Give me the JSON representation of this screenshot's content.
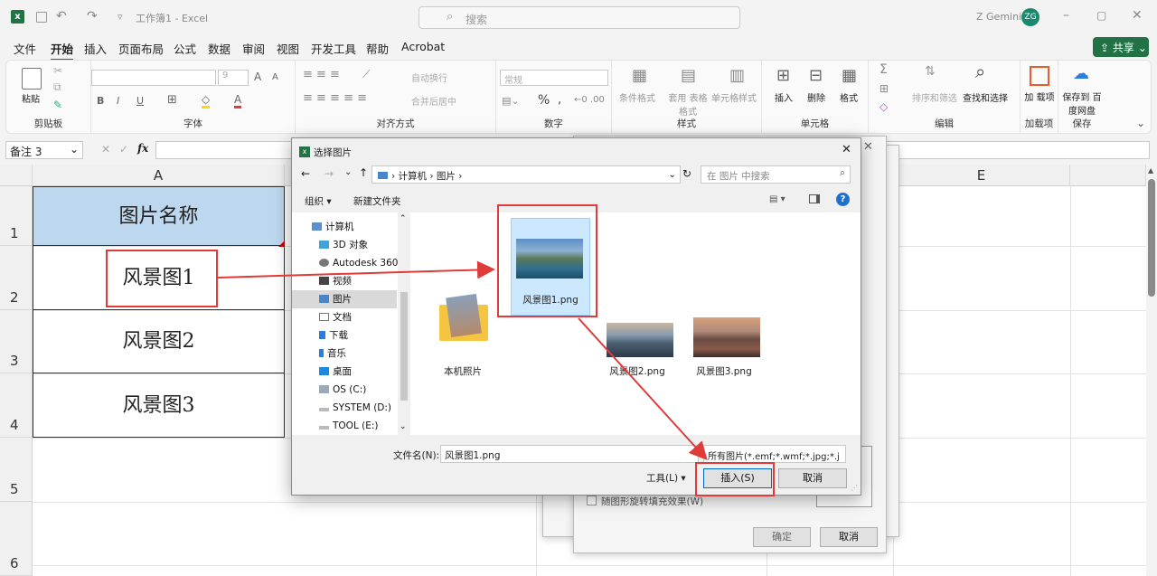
{
  "app": {
    "doc_title": "工作簿1 - Excel",
    "search_placeholder": "搜索",
    "user_name": "Z Gemini",
    "user_initials": "ZG",
    "share_label": "共享"
  },
  "menu": [
    "文件",
    "开始",
    "插入",
    "页面布局",
    "公式",
    "数据",
    "审阅",
    "视图",
    "开发工具",
    "帮助",
    "Acrobat"
  ],
  "ribbon": {
    "clipboard": {
      "paste": "粘贴",
      "label": "剪贴板"
    },
    "font": {
      "label": "字体",
      "size": "9",
      "bold": "B",
      "italic": "I",
      "underline": "U",
      "grow": "A",
      "shrink": "A"
    },
    "alignment": {
      "wrap": "自动换行",
      "merge": "合并后居中",
      "label": "对齐方式"
    },
    "number": {
      "format": "常规",
      "percent": "%",
      "label": "数字"
    },
    "styles": {
      "conditional": "条件格式",
      "table": "套用 表格格式",
      "cell": "单元格样式",
      "label": "样式"
    },
    "cells": {
      "insert": "插入",
      "delete": "删除",
      "format": "格式",
      "label": "单元格"
    },
    "editing": {
      "sort": "排序和筛选",
      "find": "查找和选择",
      "label": "编辑"
    },
    "addins": {
      "addins": "加 载项",
      "label": "加载项"
    },
    "save": {
      "baidu": "保存到 百度网盘",
      "label": "保存"
    }
  },
  "formula_bar": {
    "name_box": "备注 3",
    "fx": "fx"
  },
  "sheet": {
    "columns": [
      "A",
      "E"
    ],
    "rows": [
      "1",
      "2",
      "3",
      "4",
      "5",
      "6"
    ],
    "cells": [
      "图片名称",
      "风景图1",
      "风景图2",
      "风景图3"
    ]
  },
  "behind_dialog": {
    "checkbox_label": "随图形旋转填充效果(W)",
    "ok": "确定",
    "cancel": "取消"
  },
  "dialog": {
    "title": "选择图片",
    "breadcrumb": [
      "计算机",
      "图片"
    ],
    "search_placeholder": "在 图片 中搜索",
    "organize": "组织 ▾",
    "new_folder": "新建文件夹",
    "nav": [
      "计算机",
      "3D 对象",
      "Autodesk 360",
      "视频",
      "图片",
      "文档",
      "下载",
      "音乐",
      "桌面",
      "OS (C:)",
      "SYSTEM (D:)",
      "TOOL (E:)"
    ],
    "files": [
      "本机照片",
      "风景图1.png",
      "风景图2.png",
      "风景图3.png"
    ],
    "filename_label": "文件名(N):",
    "filename_value": "风景图1.png",
    "filter": "所有图片(*.emf;*.wmf;*.jpg;*.j",
    "tools": "工具(L)",
    "insert": "插入(S)",
    "cancel": "取消"
  },
  "colors": {
    "excel_green": "#217346",
    "header_fill": "#bdd7ee",
    "annotation_red": "#e03a3a",
    "selected_file": "#cce8ff"
  }
}
